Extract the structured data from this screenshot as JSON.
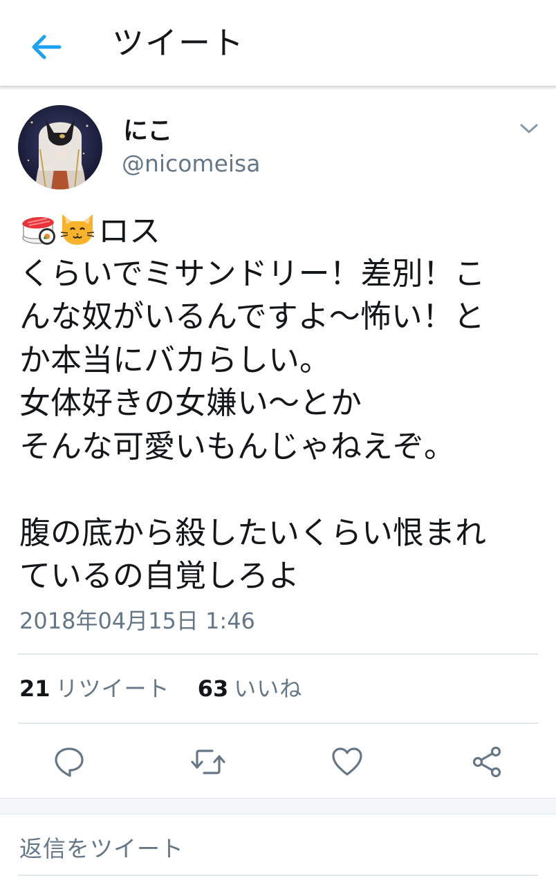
{
  "header": {
    "title": "ツイート",
    "back_icon": "back-arrow-icon",
    "accent": "#1da1f2"
  },
  "tweet": {
    "author": {
      "display_name": "にこ",
      "handle": "@nicomeisa"
    },
    "emojis": [
      "sushi",
      "cat-face"
    ],
    "lines": [
      "ロス",
      "くらいでミサンドリー！差別！こ",
      "んな奴がいるんですよ〜怖い！と",
      "か本当にバカらしい。",
      "女体好きの女嫌い〜とか",
      "そんな可愛いもんじゃねえぞ。",
      "",
      "腹の底から殺したいくらい恨まれ",
      "ているの自覚しろよ"
    ],
    "timestamp": "2018年04月15日 1:46",
    "stats": {
      "retweets": "21",
      "retweets_label": "リツイート",
      "likes": "63",
      "likes_label": "いいね"
    }
  },
  "actions": [
    "reply-icon",
    "retweet-icon",
    "like-icon",
    "share-icon"
  ],
  "reply": {
    "placeholder": "返信をツイート"
  },
  "colors": {
    "text": "#14171a",
    "secondary": "#657786",
    "divider": "#e1e8ed",
    "accent": "#1da1f2"
  }
}
